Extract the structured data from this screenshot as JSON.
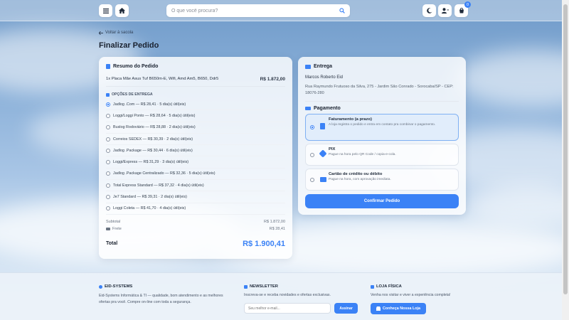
{
  "colors": {
    "accent": "#3b82f6",
    "card_bg": "#ffffff",
    "selected_payment_bg": "#e1edfb"
  },
  "header": {
    "menu_icon": "hamburger-icon",
    "home_icon": "home-icon",
    "search": {
      "placeholder": "O que você procura?",
      "icon": "search-icon"
    },
    "theme_icon": "moon-icon",
    "user_icon": "user-icon",
    "cart": {
      "icon": "cart-icon",
      "count": "0"
    }
  },
  "page": {
    "back_label": "Voltar à sacola",
    "title": "Finalizar Pedido"
  },
  "summary": {
    "title": "Resumo do Pedido",
    "item": {
      "name": "1x Placa Mãe Asus Tuf B650m-E, Wifi, Amd Am5, B650, Ddr5",
      "price": "R$ 1.872,00"
    },
    "options_title": "OPÇÕES DE ENTREGA",
    "options": [
      {
        "label": "Jadlog .Com — R$ 28,41 · 5 dia(s) útil(eis)",
        "selected": true
      },
      {
        "label": "Loggi/Loggi Ponto — R$ 28,64 · 5 dia(s) útil(eis)",
        "selected": false
      },
      {
        "label": "Buslog Rodoviário — R$ 28,88 · 2 dia(s) útil(eis)",
        "selected": false
      },
      {
        "label": "Correios SEDEX — R$ 30,39 · 2 dia(s) útil(eis)",
        "selected": false
      },
      {
        "label": "Jadlog .Package — R$ 30,44 · 6 dia(s) útil(eis)",
        "selected": false
      },
      {
        "label": "Loggi/Express — R$ 31,29 · 3 dia(s) útil(eis)",
        "selected": false
      },
      {
        "label": "Jadlog .Package Centralizado — R$ 32,36 · 5 dia(s) útil(eis)",
        "selected": false
      },
      {
        "label": "Total Express Standard — R$ 37,32 · 4 dia(s) útil(eis)",
        "selected": false
      },
      {
        "label": "Je7 Standard — R$ 39,31 · 2 dia(s) útil(eis)",
        "selected": false
      },
      {
        "label": "Loggi Coleta — R$ 41,70 · 4 dia(s) útil(eis)",
        "selected": false
      }
    ],
    "subtotal_label": "Subtotal",
    "subtotal_value": "R$ 1.872,00",
    "freight_label": "Frete",
    "freight_value": "R$ 28,41",
    "total_label": "Total",
    "total_value": "R$ 1.900,41"
  },
  "delivery": {
    "title": "Entrega",
    "name": "Marcos Roberto Eid",
    "address": "Rua Raymundo Frutuoso da Silva, 275 - Jardim São Conrado - Sorocaba/SP - CEP: 18076-280"
  },
  "payment": {
    "title": "Pagamento",
    "methods": [
      {
        "title": "Faturamento (a prazo)",
        "desc": "A loja registra o pedido e entra em contato pra combinar o pagamento.",
        "icon": "document-icon",
        "selected": true
      },
      {
        "title": "PIX",
        "desc": "Pague na hora pelo QR Code / copia-e-cola.",
        "icon": "pix-icon",
        "selected": false
      },
      {
        "title": "Cartão de crédito ou débito",
        "desc": "Pague na hora, com aprovação imediata.",
        "icon": "credit-card-icon",
        "selected": false
      }
    ],
    "confirm_label": "Confirmar Pedido"
  },
  "footer": {
    "brand": {
      "title": "EID-SYSTEMS",
      "text": "Eid-Systems Informática & TI — qualidade, bom atendimento e as melhores ofertas pra você. Compre on-line com toda a segurança."
    },
    "newsletter": {
      "title": "NEWSLETTER",
      "text": "Inscreva-se e receba novidades e ofertas exclusivas.",
      "placeholder": "Seu melhor e-mail...",
      "button": "Assinar"
    },
    "store": {
      "title": "LOJA FÍSICA",
      "text": "Venha nos visitar e viver a experiência completa!",
      "button": "Conheça Nossa Loja"
    }
  }
}
